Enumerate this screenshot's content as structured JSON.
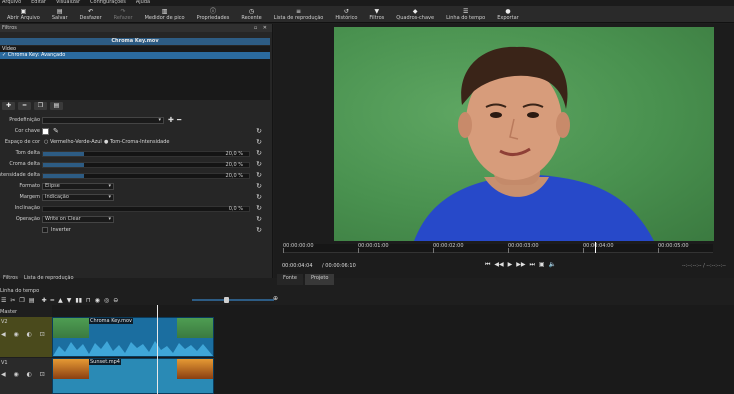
{
  "menu": [
    "Arquivo",
    "Editar",
    "Visualizar",
    "Configurações",
    "Ajuda"
  ],
  "toolbar": [
    {
      "icon": "open-icon",
      "glyph": "▣",
      "label": "Abrir Arquivo",
      "enabled": true
    },
    {
      "icon": "save-icon",
      "glyph": "▤",
      "label": "Salvar",
      "enabled": true
    },
    {
      "icon": "undo-icon",
      "glyph": "↶",
      "label": "Desfazer",
      "enabled": true
    },
    {
      "icon": "redo-icon",
      "glyph": "↷",
      "label": "Refazer",
      "enabled": false
    },
    {
      "icon": "peak-meter-icon",
      "glyph": "▥",
      "label": "Medidor de pico",
      "enabled": true
    },
    {
      "icon": "properties-icon",
      "glyph": "ⓘ",
      "label": "Propriedades",
      "enabled": true
    },
    {
      "icon": "recent-icon",
      "glyph": "◷",
      "label": "Recente",
      "enabled": true
    },
    {
      "icon": "playlist-icon",
      "glyph": "≡",
      "label": "Lista de reprodução",
      "enabled": true
    },
    {
      "icon": "history-icon",
      "glyph": "↺",
      "label": "Histórico",
      "enabled": true
    },
    {
      "icon": "filters-icon",
      "glyph": "▼",
      "label": "Filtros",
      "enabled": true
    },
    {
      "icon": "keyframes-icon",
      "glyph": "◆",
      "label": "Quadros-chave",
      "enabled": true
    },
    {
      "icon": "timeline-icon",
      "glyph": "☰",
      "label": "Linha do tempo",
      "enabled": true
    },
    {
      "icon": "export-icon",
      "glyph": "●",
      "label": "Exportar",
      "enabled": true
    }
  ],
  "filters": {
    "panel_title": "Filtros",
    "clip_name": "Chroma Key.mov",
    "section": "Vídeo",
    "items": [
      "✓ Chroma Key: Avançado"
    ]
  },
  "preset": {
    "label": "Predefinição",
    "value": ""
  },
  "controls": {
    "key_color_label": "Cor chave",
    "key_color": "#ffffff",
    "color_space_label": "Espaço de cor",
    "color_space_options": [
      "Vermelho-Verde-Azul",
      "Tom-Croma-Intensidade"
    ],
    "color_space_selected": 1,
    "sliders": [
      {
        "label": "Tom delta",
        "value": 20.0,
        "text": "20,0 %"
      },
      {
        "label": "Croma delta",
        "value": 20.0,
        "text": "20,0 %"
      },
      {
        "label": "Intensidade delta",
        "value": 20.0,
        "text": "20,0 %"
      }
    ],
    "format_label": "Formato",
    "format_value": "Elipse",
    "edge_label": "Margem",
    "edge_value": "Indicação",
    "slope_label": "Inclinação",
    "slope_value": 0,
    "slope_text": "0,0 %",
    "operation_label": "Operação",
    "operation_value": "Write on Clear",
    "invert_label": "Inverter"
  },
  "player": {
    "ruler_ticks": [
      "00:00:00:00",
      "00:00:01:00",
      "00:00:02:00",
      "00:00:03:00",
      "00:00:04:00",
      "00:00:05:00"
    ],
    "current": "00:00:04:04",
    "duration": "/ 00:00:06:10",
    "right_marks": "--:--:--:--  /  --:--:--:--",
    "tabs": [
      "Fonte",
      "Projeto"
    ]
  },
  "bottom_tabs": [
    "Filtros",
    "Lista de reprodução"
  ],
  "timeline": {
    "title": "Linha do tempo",
    "master": "Master",
    "tracks": [
      {
        "name": "V2",
        "clip": "Chroma Key.mov"
      },
      {
        "name": "V1",
        "clip": "Sunset.mp4"
      }
    ]
  }
}
